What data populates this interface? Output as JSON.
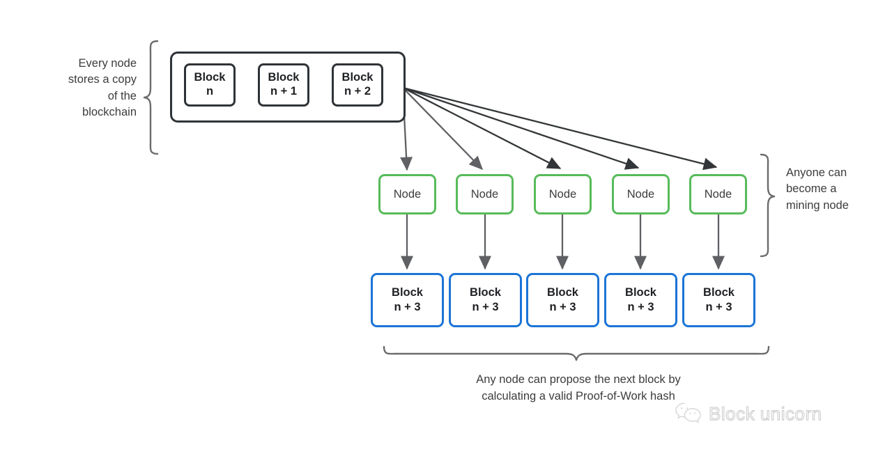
{
  "diagram": {
    "title": "Blockchain mining node diagram",
    "colors": {
      "dark": "#2f3337",
      "green": "#57bb5a",
      "blue": "#1b74d6",
      "brace": "#6b6b6b",
      "arrow": "#4a4a4a",
      "text": "#3c3c3c",
      "background": "#ffffff"
    },
    "labels": {
      "left": "Every node\nstores a copy\nof the\nblockchain",
      "right": "Anyone can\nbecome a\nmining node",
      "bottom": "Any node can propose the next block by\ncalculating a valid Proof-of-Work hash"
    },
    "chain": {
      "blocks": [
        {
          "line1": "Block",
          "line2": "n"
        },
        {
          "line1": "Block",
          "line2": "n + 1"
        },
        {
          "line1": "Block",
          "line2": "n + 2"
        }
      ]
    },
    "nodes": [
      {
        "label": "Node"
      },
      {
        "label": "Node"
      },
      {
        "label": "Node"
      },
      {
        "label": "Node"
      },
      {
        "label": "Node"
      }
    ],
    "new_blocks": [
      {
        "line1": "Block",
        "line2": "n + 3"
      },
      {
        "line1": "Block",
        "line2": "n + 3"
      },
      {
        "line1": "Block",
        "line2": "n + 3"
      },
      {
        "line1": "Block",
        "line2": "n + 3"
      },
      {
        "line1": "Block",
        "line2": "n + 3"
      }
    ],
    "watermark": {
      "icon": "wechat-icon",
      "text": "Block unicorn"
    }
  }
}
